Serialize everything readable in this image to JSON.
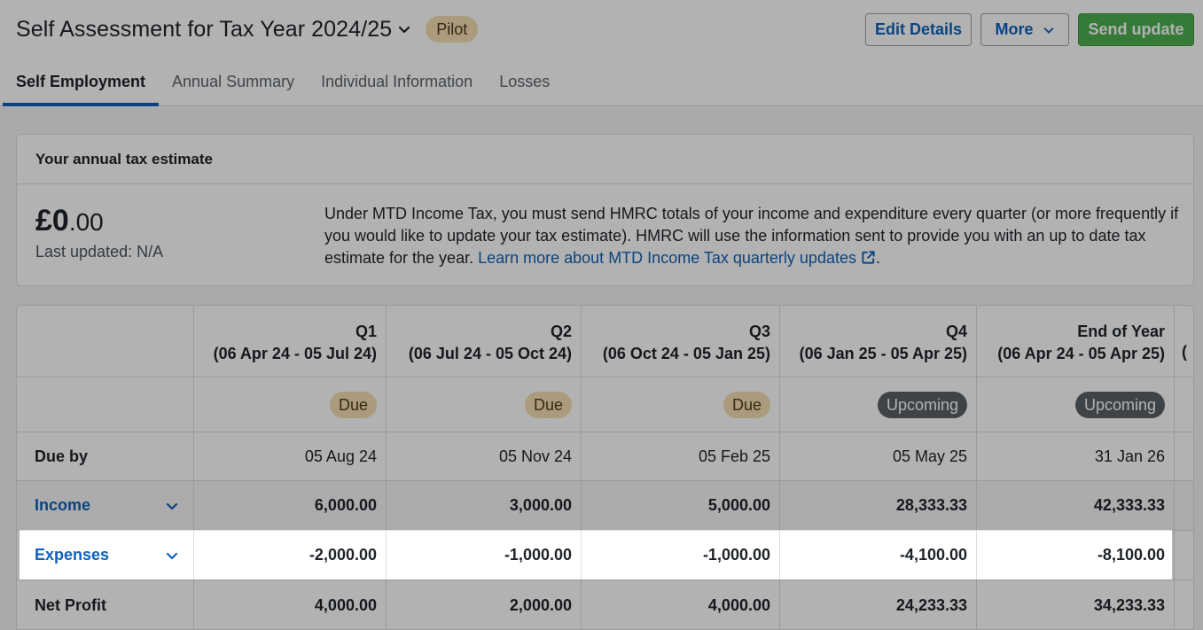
{
  "header": {
    "title": "Self Assessment for Tax Year 2024/25",
    "badge": "Pilot",
    "edit_label": "Edit Details",
    "more_label": "More",
    "send_label": "Send update"
  },
  "tabs": [
    {
      "label": "Self Employment",
      "active": true
    },
    {
      "label": "Annual Summary",
      "active": false
    },
    {
      "label": "Individual Information",
      "active": false
    },
    {
      "label": "Losses",
      "active": false
    }
  ],
  "estimate": {
    "heading": "Your annual tax estimate",
    "amount_main": "£0",
    "amount_pence": ".00",
    "last_updated": "Last updated: N/A",
    "description": "Under MTD Income Tax, you must send HMRC totals of your income and expenditure every quarter (or more frequently if you would like to update your tax estimate). HMRC will use the information sent to provide you with an up to date tax estimate for the year. ",
    "link_text": "Learn more about MTD Income Tax quarterly updates",
    "after_link": "."
  },
  "table": {
    "columns": [
      {
        "title": "Q1",
        "range": "(06 Apr 24 - 05 Jul 24)",
        "status": "Due",
        "due_by": "05 Aug 24",
        "income": "6,000.00",
        "expenses": "-2,000.00",
        "net": "4,000.00"
      },
      {
        "title": "Q2",
        "range": "(06 Jul 24 - 05 Oct 24)",
        "status": "Due",
        "due_by": "05 Nov 24",
        "income": "3,000.00",
        "expenses": "-1,000.00",
        "net": "2,000.00"
      },
      {
        "title": "Q3",
        "range": "(06 Oct 24 - 05 Jan 25)",
        "status": "Due",
        "due_by": "05 Feb 25",
        "income": "5,000.00",
        "expenses": "-1,000.00",
        "net": "4,000.00"
      },
      {
        "title": "Q4",
        "range": "(06 Jan 25 - 05 Apr 25)",
        "status": "Upcoming",
        "due_by": "05 May 25",
        "income": "28,333.33",
        "expenses": "-4,100.00",
        "net": "24,233.33"
      },
      {
        "title": "End of Year",
        "range": "(06 Apr 24 - 05 Apr 25)",
        "status": "Upcoming",
        "due_by": "31 Jan 26",
        "income": "42,333.33",
        "expenses": "-8,100.00",
        "net": "34,233.33"
      }
    ],
    "partial_header": "(",
    "rows": {
      "due_by": "Due by",
      "income": "Income",
      "expenses": "Expenses",
      "net": "Net Profit"
    }
  },
  "colors": {
    "accent": "#1061b8",
    "send_button": "#4caf50",
    "due_badge": "#f4deb3",
    "upcoming_badge": "#5a6168"
  }
}
